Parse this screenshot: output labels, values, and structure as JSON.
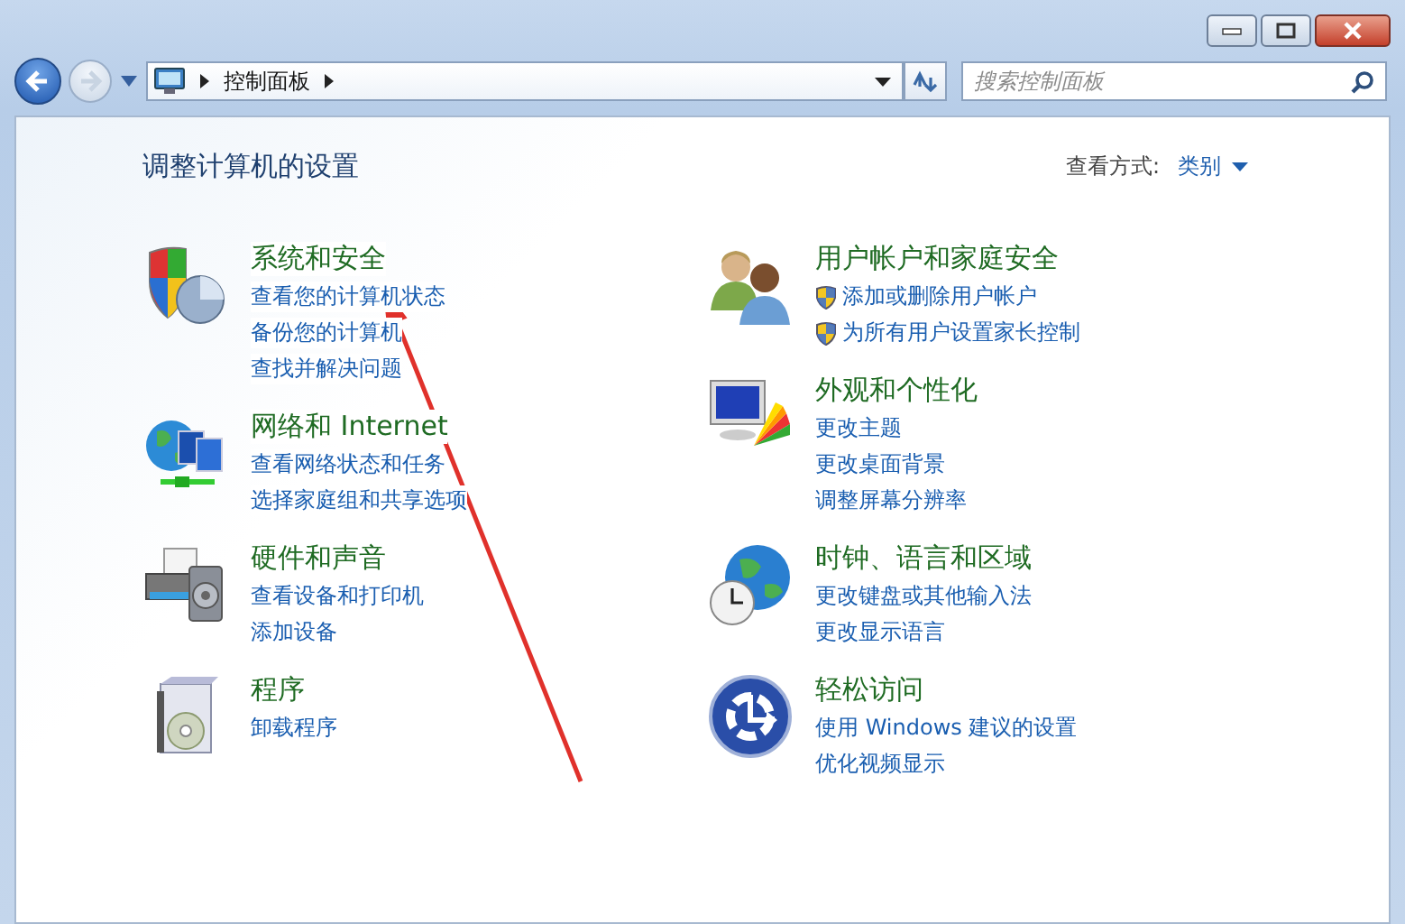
{
  "window": {
    "controls": [
      {
        "kind": "minimize"
      },
      {
        "kind": "maximize"
      },
      {
        "kind": "close"
      }
    ]
  },
  "navigation": {
    "breadcrumb": [
      "控制面板"
    ],
    "search": {
      "placeholder": "搜索控制面板"
    }
  },
  "header": {
    "title": "调整计算机的设置",
    "view_by_label": "查看方式:",
    "view_by_value": "类别"
  },
  "columns": [
    {
      "categories": [
        {
          "kind": "security",
          "title": "系统和安全",
          "links": [
            {
              "kind": "plain",
              "text": "查看您的计算机状态"
            },
            {
              "kind": "plain",
              "text": "备份您的计算机"
            },
            {
              "kind": "plain",
              "text": "查找并解决问题"
            }
          ]
        },
        {
          "kind": "network",
          "title": "网络和 Internet",
          "links": [
            {
              "kind": "plain",
              "text": "查看网络状态和任务"
            },
            {
              "kind": "plain",
              "text": "选择家庭组和共享选项"
            }
          ]
        },
        {
          "kind": "hardware",
          "title": "硬件和声音",
          "links": [
            {
              "kind": "plain",
              "text": "查看设备和打印机"
            },
            {
              "kind": "plain",
              "text": "添加设备"
            }
          ]
        },
        {
          "kind": "programs",
          "title": "程序",
          "links": [
            {
              "kind": "plain",
              "text": "卸载程序"
            }
          ]
        }
      ]
    },
    {
      "categories": [
        {
          "kind": "users",
          "title": "用户帐户和家庭安全",
          "links": [
            {
              "kind": "shield",
              "text": "添加或删除用户帐户"
            },
            {
              "kind": "shield",
              "text": "为所有用户设置家长控制"
            }
          ]
        },
        {
          "kind": "appearance",
          "title": "外观和个性化",
          "links": [
            {
              "kind": "plain",
              "text": "更改主题"
            },
            {
              "kind": "plain",
              "text": "更改桌面背景"
            },
            {
              "kind": "plain",
              "text": "调整屏幕分辨率"
            }
          ]
        },
        {
          "kind": "clock",
          "title": "时钟、语言和区域",
          "links": [
            {
              "kind": "plain",
              "text": "更改键盘或其他输入法"
            },
            {
              "kind": "plain",
              "text": "更改显示语言"
            }
          ]
        },
        {
          "kind": "access",
          "title": "轻松访问",
          "links": [
            {
              "kind": "plain",
              "text": "使用 Windows 建议的设置"
            },
            {
              "kind": "plain",
              "text": "优化视频显示"
            }
          ]
        }
      ]
    }
  ]
}
